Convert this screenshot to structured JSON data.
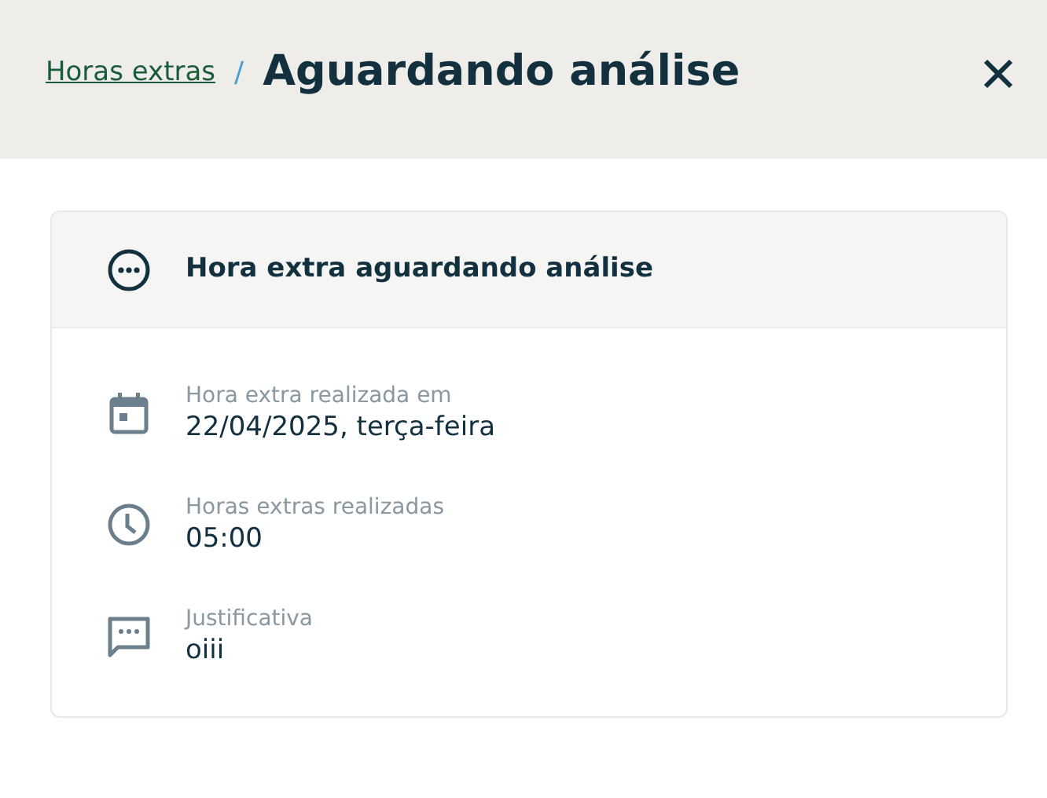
{
  "header": {
    "breadcrumb_link": "Horas extras",
    "separator": "/",
    "title": "Aguardando análise"
  },
  "card": {
    "status": "Hora extra aguardando análise",
    "items": [
      {
        "kind": "calendar",
        "label": "Hora extra realizada em",
        "value": "22/04/2025, terça-feira"
      },
      {
        "kind": "clock",
        "label": "Horas extras realizadas",
        "value": "05:00"
      },
      {
        "kind": "comment",
        "label": "Justificativa",
        "value": "oiii"
      }
    ]
  }
}
